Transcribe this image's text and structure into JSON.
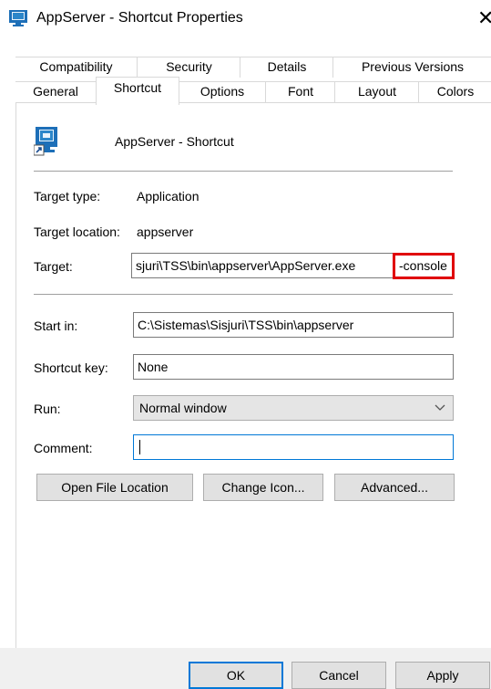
{
  "window": {
    "title": "AppServer - Shortcut Properties",
    "icon": "shortcut-app-icon",
    "close_glyph": "✕"
  },
  "tabs_row1": [
    "Compatibility",
    "Security",
    "Details",
    "Previous Versions"
  ],
  "tabs_row2": [
    "General",
    "Shortcut",
    "Options",
    "Font",
    "Layout",
    "Colors"
  ],
  "active_tab": "Shortcut",
  "shortcut_name": "AppServer - Shortcut",
  "fields": {
    "target_type_label": "Target type:",
    "target_type_value": "Application",
    "target_location_label": "Target location:",
    "target_location_value": "appserver",
    "target_label": "Target:",
    "target_value_main": "sjuri\\TSS\\bin\\appserver\\AppServer.exe",
    "target_value_highlight": "-console",
    "start_in_label": "Start in:",
    "start_in_value": "C:\\Sistemas\\Sisjuri\\TSS\\bin\\appserver",
    "shortcut_key_label": "Shortcut key:",
    "shortcut_key_value": "None",
    "run_label": "Run:",
    "run_value": "Normal window",
    "comment_label": "Comment:",
    "comment_value": ""
  },
  "buttons": {
    "open_file_location": "Open File Location",
    "change_icon": "Change Icon...",
    "advanced": "Advanced...",
    "ok": "OK",
    "cancel": "Cancel",
    "apply": "Apply"
  },
  "colors": {
    "highlight_border": "#e0000a",
    "focus_border": "#0078d7",
    "footer_bg": "#f0f0f0"
  }
}
